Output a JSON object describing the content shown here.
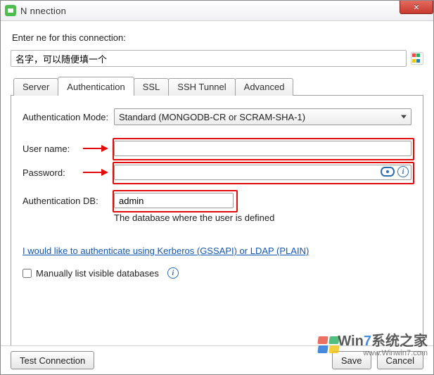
{
  "titlebar": {
    "title": "N         nnection",
    "close_label": "✕"
  },
  "prompt": "Enter         ne for this connection:",
  "connection_name": {
    "value": "名字，可以随便填一个"
  },
  "tabs": {
    "items": [
      {
        "label": "Server"
      },
      {
        "label": "Authentication"
      },
      {
        "label": "SSL"
      },
      {
        "label": "SSH Tunnel"
      },
      {
        "label": "Advanced"
      }
    ],
    "active_index": 1
  },
  "auth": {
    "mode_label": "Authentication Mode:",
    "mode_value": "Standard (MONGODB-CR or SCRAM-SHA-1)",
    "username_label": "User name:",
    "username_value": "",
    "password_label": "Password:",
    "password_value": "",
    "db_label": "Authentication DB:",
    "db_value": "admin",
    "db_hint": "The database where the user is defined",
    "kerberos_link": "I would like to authenticate using Kerberos (GSSAPI) or LDAP (PLAIN)",
    "manual_list_label": "Manually list visible databases",
    "manual_list_checked": false
  },
  "buttons": {
    "test": "Test Connection",
    "save": "Save",
    "cancel": "Cancel"
  },
  "watermark": {
    "brand_a": "Win",
    "brand_b": "7",
    "brand_c": "系统之家",
    "url": "www.Winwin7.com"
  },
  "icons": {
    "info_glyph": "i"
  }
}
